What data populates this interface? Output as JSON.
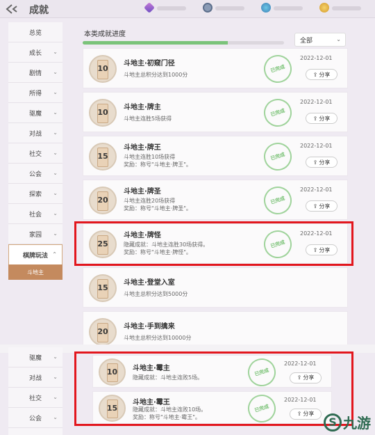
{
  "header": {
    "title": "成就",
    "icons": [
      "crystal-icon",
      "gear-coin-icon",
      "globe-icon",
      "gold-coin-icon"
    ]
  },
  "sidebar": {
    "items": [
      {
        "label": "总览",
        "chev": ""
      },
      {
        "label": "成长",
        "chev": "⌄"
      },
      {
        "label": "剧情",
        "chev": "⌄"
      },
      {
        "label": "所得",
        "chev": "⌄"
      },
      {
        "label": "驱魔",
        "chev": "⌄"
      },
      {
        "label": "对战",
        "chev": "⌄"
      },
      {
        "label": "社交",
        "chev": "⌄"
      },
      {
        "label": "公会",
        "chev": "⌄"
      },
      {
        "label": "探索",
        "chev": "⌄"
      },
      {
        "label": "社会",
        "chev": "⌄"
      },
      {
        "label": "家园",
        "chev": "⌄"
      },
      {
        "label": "棋牌玩法",
        "chev": "⌃"
      }
    ],
    "sub_item": "斗地主",
    "lower_items": [
      {
        "label": "驱魔",
        "chev": "⌄"
      },
      {
        "label": "对战",
        "chev": "⌄"
      },
      {
        "label": "社交",
        "chev": "⌄"
      },
      {
        "label": "公会",
        "chev": "⌄"
      },
      {
        "label": "探索",
        "chev": "⌄"
      }
    ]
  },
  "main": {
    "section_title": "本类成就进度",
    "progress_fraction": 0.72,
    "filter_label": "全部",
    "stamp_text": "已完成",
    "share_label": "分享",
    "achievements": [
      {
        "num": "10",
        "name": "斗地主·初窥门径",
        "desc1": "斗地主总积分达到1000分",
        "desc2": "",
        "date": "2022-12-01",
        "done": true
      },
      {
        "num": "10",
        "name": "斗地主·牌主",
        "desc1": "斗地主连胜5场获得",
        "desc2": "",
        "date": "2022-12-01",
        "done": true
      },
      {
        "num": "15",
        "name": "斗地主·牌王",
        "desc1": "斗地主连胜10场获得",
        "desc2": "奖励：称号\"斗地主·牌王\"。",
        "date": "2022-12-01",
        "done": true
      },
      {
        "num": "20",
        "name": "斗地主·牌圣",
        "desc1": "斗地主连胜20场获得",
        "desc2": "奖励：称号\"斗地主·牌圣\"。",
        "date": "2022-12-01",
        "done": true
      },
      {
        "num": "25",
        "name": "斗地主·牌怪",
        "desc1": "隐藏成就：斗地主连胜30场获得。",
        "desc2": "奖励：称号\"斗地主·牌怪\"。",
        "date": "2022-12-01",
        "done": true
      },
      {
        "num": "15",
        "name": "斗地主·登堂入室",
        "desc1": "斗地主总积分达到5000分",
        "desc2": "",
        "date": "",
        "done": false
      },
      {
        "num": "20",
        "name": "斗地主·手到擒来",
        "desc1": "斗地主总积分达到10000分",
        "desc2": "",
        "date": "",
        "done": false
      }
    ],
    "lower_achievements": [
      {
        "num": "10",
        "name": "斗地主·霉主",
        "desc1": "隐藏成就：斗地主连败5场。",
        "desc2": "",
        "date": "2022-12-01",
        "done": true
      },
      {
        "num": "15",
        "name": "斗地主·霉王",
        "desc1": "隐藏成就：斗地主连败10场。",
        "desc2": "奖励：称号\"斗地主·霉王\"。",
        "date": "2022-12-01",
        "done": true
      }
    ]
  },
  "watermark": {
    "logo_letter": "S",
    "text": "九游"
  }
}
